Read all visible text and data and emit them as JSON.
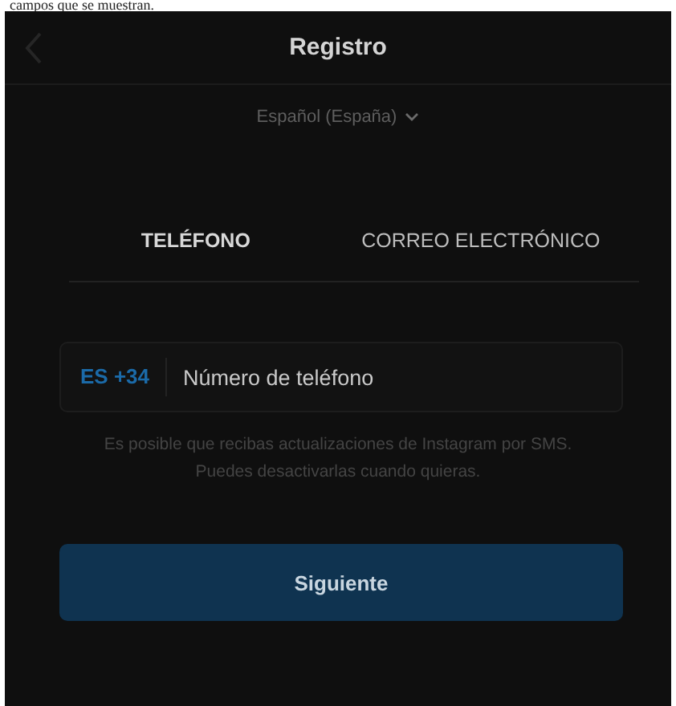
{
  "caption": "campos que se muestran.",
  "header": {
    "title": "Registro"
  },
  "language": {
    "label": "Español (España)"
  },
  "tabs": [
    {
      "label": "TELÉFONO",
      "selected": true
    },
    {
      "label": "CORREO ELECTRÓNICO",
      "selected": false
    }
  ],
  "phone_field": {
    "country_code": "ES +34",
    "placeholder": "Número de teléfono"
  },
  "hint": "Es posible que recibas actualizaciones de Instagram por SMS. Puedes desactivarlas cuando quieras.",
  "buttons": [
    "Siguiente"
  ]
}
